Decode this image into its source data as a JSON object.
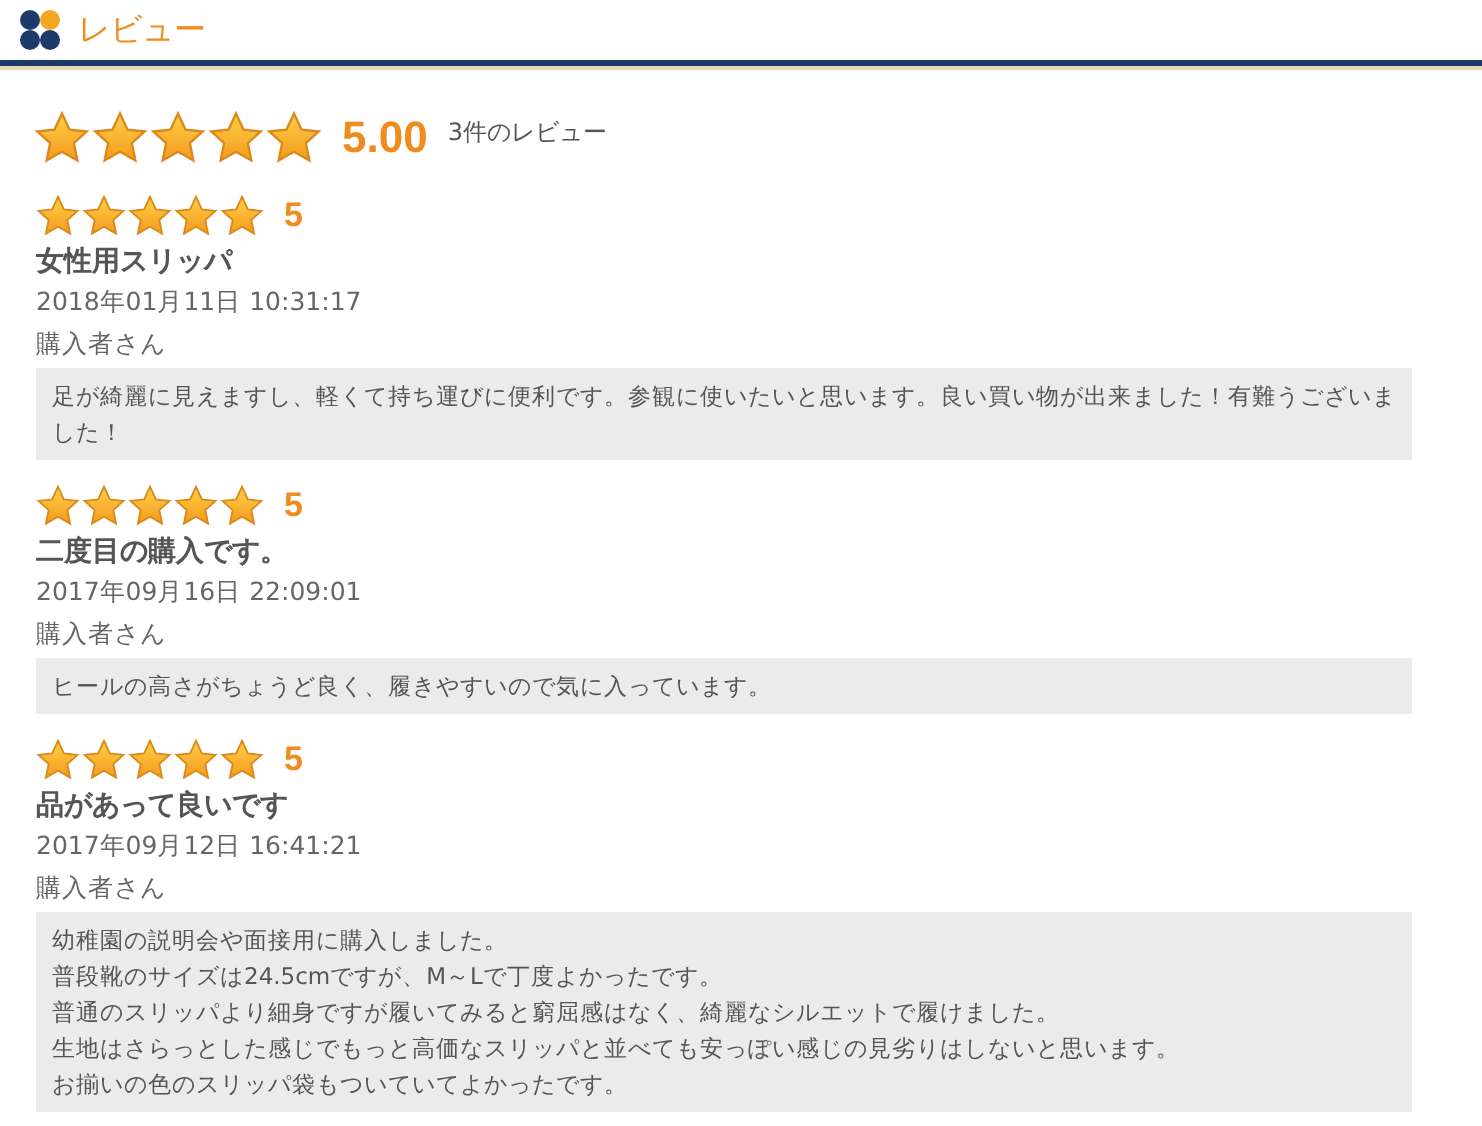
{
  "header": {
    "title": "レビュー"
  },
  "summary": {
    "stars": 5,
    "score": "5.00",
    "count": "3件のレビュー"
  },
  "reviews": [
    {
      "stars": 5,
      "rating": "5",
      "title": "女性用スリッパ",
      "date": "2018年01月11日 10:31:17",
      "author": "購入者さん",
      "body": [
        "足が綺麗に見えますし、軽くて持ち運びに便利です。参観に使いたいと思います。良い買い物が出来ました！有難うございました！"
      ]
    },
    {
      "stars": 5,
      "rating": "5",
      "title": "二度目の購入です。",
      "date": "2017年09月16日 22:09:01",
      "author": "購入者さん",
      "body": [
        "ヒールの高さがちょうど良く、履きやすいので気に入っています。"
      ]
    },
    {
      "stars": 5,
      "rating": "5",
      "title": "品があって良いです",
      "date": "2017年09月12日 16:41:21",
      "author": "購入者さん",
      "body": [
        "幼稚園の説明会や面接用に購入しました。",
        "普段靴のサイズは24.5cmですが、M～Lで丁度よかったです。",
        "普通のスリッパより細身ですが履いてみると窮屈感はなく、綺麗なシルエットで履けました。",
        "生地はさらっとした感じでもっと高価なスリッパと並べても安っぽい感じの見劣りはしないと思います。",
        "お揃いの色のスリッパ袋もついていてよかったです。"
      ]
    }
  ]
}
